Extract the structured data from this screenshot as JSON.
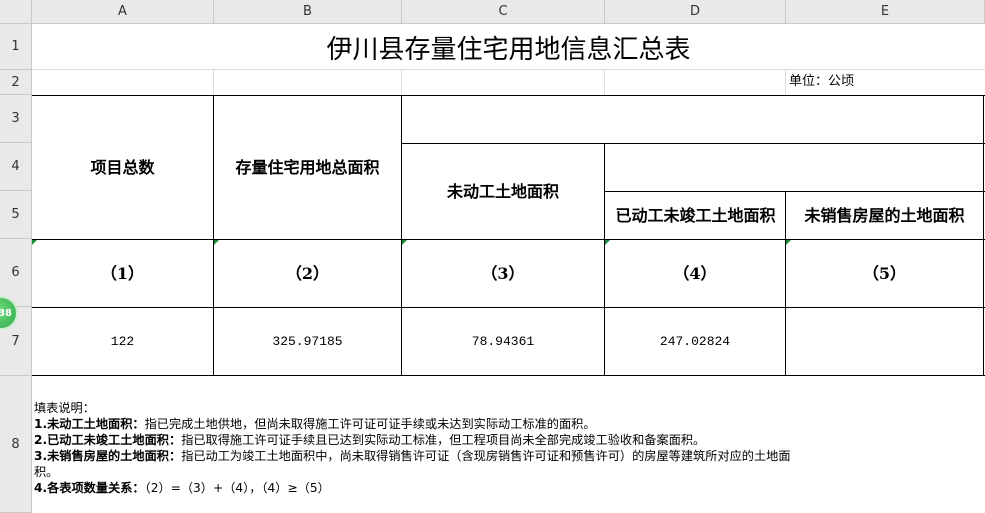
{
  "columns": [
    "A",
    "B",
    "C",
    "D",
    "E"
  ],
  "rows": [
    "1",
    "2",
    "3",
    "4",
    "5",
    "6",
    "7",
    "8"
  ],
  "title": "伊川县存量住宅用地信息汇总表",
  "unit": "单位：公顷",
  "headers": {
    "col1": "项目总数",
    "col2": "存量住宅用地总面积",
    "col3": "未动工土地面积",
    "col4": "已动工未竣工土地面积",
    "col5": "未销售房屋的土地面积"
  },
  "index_row": [
    "（1）",
    "（2）",
    "（3）",
    "（4）",
    "（5）"
  ],
  "values": [
    "122",
    "325.97185",
    "78.94361",
    "247.02824",
    ""
  ],
  "notes": {
    "heading": "填表说明：",
    "n1_term": "1.未动工土地面积：",
    "n1_text": "指已完成土地供地，但尚未取得施工许可证可证手续或未达到实际动工标准的面积。",
    "n2_term": "2.已动工未竣工土地面积：",
    "n2_text": "指已取得施工许可证手续且已达到实际动工标准，但工程项目尚未全部完成竣工验收和备案面积。",
    "n3_term": "3.未销售房屋的土地面积：",
    "n3_text": "指已动工为竣工土地面积中，尚未取得销售许可证（含现房销售许可证和预售许可）的房屋等建筑所对应的土地面",
    "n3_cont": "积。",
    "n4_term": "4.各表项数量关系：",
    "n4_text": "（2）=（3）+（4），（4）≥（5）"
  },
  "badge": "38"
}
